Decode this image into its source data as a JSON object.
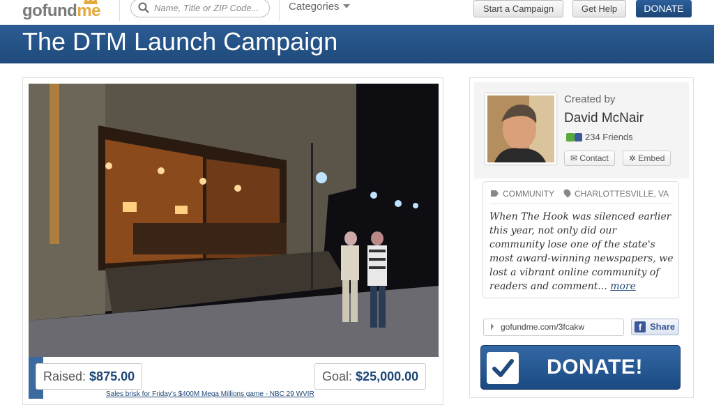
{
  "nav": {
    "logo_go": "go",
    "logo_fund": "fund",
    "logo_me": "me",
    "search_placeholder": "Name, Title or ZIP Code...",
    "categories_label": "Categories",
    "start_campaign": "Start a Campaign",
    "get_help": "Get Help",
    "donate": "DONATE"
  },
  "campaign": {
    "title": "The DTM Launch Campaign",
    "raised_label": "Raised:",
    "raised_value": "$875.00",
    "goal_label": "Goal:",
    "goal_value": "$25,000.00",
    "progress_fraction": 0.035
  },
  "creator": {
    "created_by_label": "Created by",
    "name": "David McNair",
    "friends": "234 Friends",
    "contact_label": "Contact",
    "embed_label": "Embed"
  },
  "story": {
    "category": "Community",
    "location": "Charlottesville, VA",
    "text": "When The Hook was silenced earlier this year, not only did our community lose one of the state's most award-winning newspapers, we lost a vibrant online community of readers and comment...",
    "more_link": "more"
  },
  "share": {
    "short_url": "gofundme.com/3fcakw",
    "share_label": "Share"
  },
  "donate_button": "DONATE!",
  "ticker_text": "Sales brisk for Friday's $400M Mega Millions game - NBC 29 WVIR",
  "colors": {
    "brand_blue": "#1f4a7b",
    "logo_orange": "#e6a83a",
    "facebook_blue": "#3b5998"
  }
}
